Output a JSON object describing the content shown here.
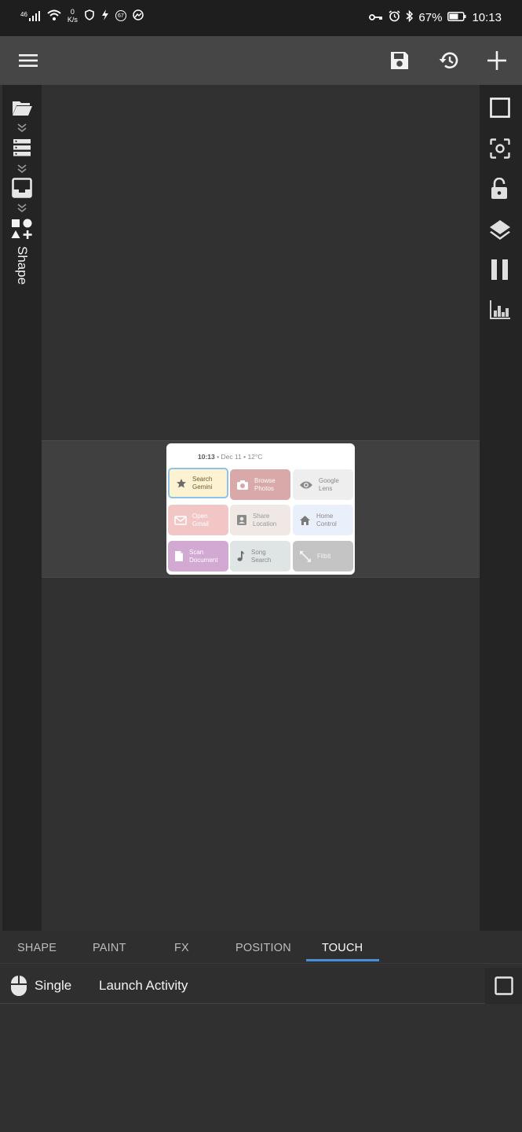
{
  "status_bar": {
    "network": "46",
    "data_rate_value": "0",
    "data_rate_unit": "K/s",
    "notification_badge": "67",
    "battery": "67%",
    "time": "10:13"
  },
  "toolbar": {
    "menu_icon": "hamburger-menu-icon",
    "save_icon": "floppy-disk-icon",
    "history_icon": "history-icon",
    "add_icon": "plus-icon"
  },
  "left_rail": {
    "items": [
      "folder-icon",
      "list-icon",
      "layout-icon",
      "shapes-icon"
    ],
    "vertical_label": "Shape"
  },
  "right_rail": {
    "items": [
      "square-outline-icon",
      "focus-icon",
      "lock-icon",
      "layers-icon",
      "pause-icon",
      "chart-icon"
    ]
  },
  "widget": {
    "time": "10:13",
    "date_weather": " • Dec 11 • 12°C",
    "tiles": [
      {
        "line1": "Search",
        "line2": "Gemini",
        "icon": "star-icon",
        "bg": "#fdf3d3",
        "fg": "#6b5c2c"
      },
      {
        "line1": "Browse",
        "line2": "Photos",
        "icon": "camera-icon",
        "bg": "#d9a8a8",
        "fg": "#ffffff"
      },
      {
        "line1": "Google",
        "line2": "Lens",
        "icon": "eye-icon",
        "bg": "#eeeeee",
        "fg": "#8a8a8a"
      },
      {
        "line1": "Open",
        "line2": "Gmail",
        "icon": "mail-icon",
        "bg": "#f3c6c6",
        "fg": "#ffffff"
      },
      {
        "line1": "Share",
        "line2": "Location",
        "icon": "contact-icon",
        "bg": "#efe8e4",
        "fg": "#9a9a9a"
      },
      {
        "line1": "Home",
        "line2": "Control",
        "icon": "home-icon",
        "bg": "#eaf0fb",
        "fg": "#8a8a8a"
      },
      {
        "line1": "Scan",
        "line2": "Document",
        "icon": "document-icon",
        "bg": "#d2a9d2",
        "fg": "#ffffff"
      },
      {
        "line1": "Song",
        "line2": "Search",
        "icon": "music-note-icon",
        "bg": "#dfe4e5",
        "fg": "#8a8a8a"
      },
      {
        "line1": "Fitbit",
        "line2": "",
        "icon": "expand-arrows-icon",
        "bg": "#c4c4c4",
        "fg": "#f3f3f3"
      }
    ]
  },
  "tabs": [
    "SHAPE",
    "PAINT",
    "FX",
    "POSITION",
    "TOUCH"
  ],
  "active_tab": "TOUCH",
  "touch": {
    "mode": "Single",
    "action": "Launch Activity",
    "mode_icon": "mouse-icon",
    "checkbox_icon": "checkbox-icon"
  },
  "colors": {
    "accent": "#4a90d9",
    "toolbar": "#464646",
    "rail": "#242424",
    "canvas": "#313131"
  }
}
